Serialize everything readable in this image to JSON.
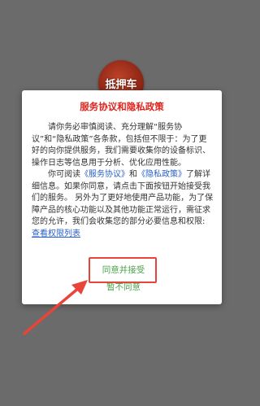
{
  "logo": {
    "text": "抵押车"
  },
  "dialog": {
    "title": "服务协议和隐私政策",
    "paragraph1": "请你务必审慎阅读、充分理解“服务协议”和“隐私政策”各条款，包括但不限于：为了更好的向你提供服务，我们需要收集你的设备标识、操作日志等信息用于分析、优化应用性能。",
    "p2_prefix": "你可阅读",
    "service_link": "《服务协议》",
    "and_text": "和",
    "privacy_link": "《隐私政策》",
    "p2_suffix": "了解详细信息。如果你同意，请点击下面按钮开始接受我们的服务。 另外为了更好地使用产品功能，为了保障产品的核心功能以及其他功能正常运行，需征求您的允许，我们会收集您的部分必要信息和权限:",
    "permission_link": "查看权限列表",
    "agree_label": "同意并接受",
    "disagree_label": "暂不同意"
  },
  "colors": {
    "title": "#e0241c",
    "link": "#2a5fc7",
    "button_text": "#4aa14a",
    "annotation": "#e8443a",
    "backdrop": "#6b6b6b"
  }
}
